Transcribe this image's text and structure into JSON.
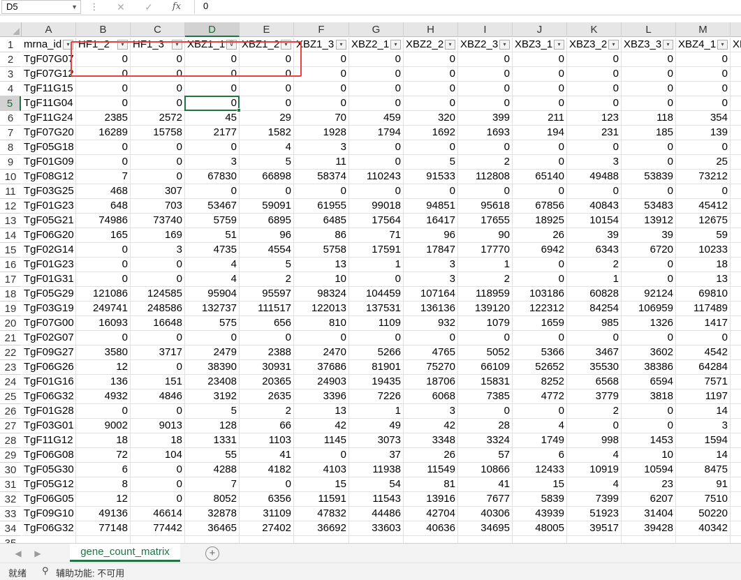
{
  "formula_bar": {
    "name_box": "D5",
    "cancel_icon": "✕",
    "enter_icon": "✓",
    "fx_label": "fx",
    "value": "0"
  },
  "columns": [
    "A",
    "B",
    "C",
    "D",
    "E",
    "F",
    "G",
    "H",
    "I",
    "J",
    "K",
    "L",
    "M"
  ],
  "selected_column": "D",
  "selected_row": "5",
  "headers": [
    "mrna_id",
    "HF1_2",
    "HF1_3",
    "XBZ1_1",
    "XBZ1_2",
    "XBZ1_3",
    "XBZ2_1",
    "XBZ2_2",
    "XBZ2_3",
    "XBZ3_1",
    "XBZ3_2",
    "XBZ3_3",
    "XBZ4_1"
  ],
  "next_header_fragment": "XB",
  "filter_icon": "▾",
  "active_filter_icon": "⊽",
  "rows": [
    {
      "n": "2",
      "id": "TgF07G07",
      "v": [
        "0",
        "0",
        "0",
        "0",
        "0",
        "0",
        "0",
        "0",
        "0",
        "0",
        "0",
        "0"
      ]
    },
    {
      "n": "3",
      "id": "TgF07G12",
      "v": [
        "0",
        "0",
        "0",
        "0",
        "0",
        "0",
        "0",
        "0",
        "0",
        "0",
        "0",
        "0"
      ]
    },
    {
      "n": "4",
      "id": "TgF11G15",
      "v": [
        "0",
        "0",
        "0",
        "0",
        "0",
        "0",
        "0",
        "0",
        "0",
        "0",
        "0",
        "0"
      ]
    },
    {
      "n": "5",
      "id": "TgF11G04",
      "v": [
        "0",
        "0",
        "0",
        "0",
        "0",
        "0",
        "0",
        "0",
        "0",
        "0",
        "0",
        "0"
      ]
    },
    {
      "n": "6",
      "id": "TgF11G24",
      "v": [
        "2385",
        "2572",
        "45",
        "29",
        "70",
        "459",
        "320",
        "399",
        "211",
        "123",
        "118",
        "354"
      ]
    },
    {
      "n": "7",
      "id": "TgF07G20",
      "v": [
        "16289",
        "15758",
        "2177",
        "1582",
        "1928",
        "1794",
        "1692",
        "1693",
        "194",
        "231",
        "185",
        "139"
      ]
    },
    {
      "n": "8",
      "id": "TgF05G18",
      "v": [
        "0",
        "0",
        "0",
        "4",
        "3",
        "0",
        "0",
        "0",
        "0",
        "0",
        "0",
        "0"
      ]
    },
    {
      "n": "9",
      "id": "TgF01G09",
      "v": [
        "0",
        "0",
        "3",
        "5",
        "11",
        "0",
        "5",
        "2",
        "0",
        "3",
        "0",
        "25"
      ]
    },
    {
      "n": "10",
      "id": "TgF08G12",
      "v": [
        "7",
        "0",
        "67830",
        "66898",
        "58374",
        "110243",
        "91533",
        "112808",
        "65140",
        "49488",
        "53839",
        "73212"
      ]
    },
    {
      "n": "11",
      "id": "TgF03G25",
      "v": [
        "468",
        "307",
        "0",
        "0",
        "0",
        "0",
        "0",
        "0",
        "0",
        "0",
        "0",
        "0"
      ]
    },
    {
      "n": "12",
      "id": "TgF01G23",
      "v": [
        "648",
        "703",
        "53467",
        "59091",
        "61955",
        "99018",
        "94851",
        "95618",
        "67856",
        "40843",
        "53483",
        "45412"
      ]
    },
    {
      "n": "13",
      "id": "TgF05G21",
      "v": [
        "74986",
        "73740",
        "5759",
        "6895",
        "6485",
        "17564",
        "16417",
        "17655",
        "18925",
        "10154",
        "13912",
        "12675"
      ]
    },
    {
      "n": "14",
      "id": "TgF06G20",
      "v": [
        "165",
        "169",
        "51",
        "96",
        "86",
        "71",
        "96",
        "90",
        "26",
        "39",
        "39",
        "59"
      ]
    },
    {
      "n": "15",
      "id": "TgF02G14",
      "v": [
        "0",
        "3",
        "4735",
        "4554",
        "5758",
        "17591",
        "17847",
        "17770",
        "6942",
        "6343",
        "6720",
        "10233"
      ]
    },
    {
      "n": "16",
      "id": "TgF01G23",
      "v": [
        "0",
        "0",
        "4",
        "5",
        "13",
        "1",
        "3",
        "1",
        "0",
        "2",
        "0",
        "18"
      ]
    },
    {
      "n": "17",
      "id": "TgF01G31",
      "v": [
        "0",
        "0",
        "4",
        "2",
        "10",
        "0",
        "3",
        "2",
        "0",
        "1",
        "0",
        "13"
      ]
    },
    {
      "n": "18",
      "id": "TgF05G29",
      "v": [
        "121086",
        "124585",
        "95904",
        "95597",
        "98324",
        "104459",
        "107164",
        "118959",
        "103186",
        "60828",
        "92124",
        "69810"
      ]
    },
    {
      "n": "19",
      "id": "TgF03G19",
      "v": [
        "249741",
        "248586",
        "132737",
        "111517",
        "122013",
        "137531",
        "136136",
        "139120",
        "122312",
        "84254",
        "106959",
        "117489"
      ]
    },
    {
      "n": "20",
      "id": "TgF07G00",
      "v": [
        "16093",
        "16648",
        "575",
        "656",
        "810",
        "1109",
        "932",
        "1079",
        "1659",
        "985",
        "1326",
        "1417"
      ]
    },
    {
      "n": "21",
      "id": "TgF02G07",
      "v": [
        "0",
        "0",
        "0",
        "0",
        "0",
        "0",
        "0",
        "0",
        "0",
        "0",
        "0",
        "0"
      ]
    },
    {
      "n": "22",
      "id": "TgF09G27",
      "v": [
        "3580",
        "3717",
        "2479",
        "2388",
        "2470",
        "5266",
        "4765",
        "5052",
        "5366",
        "3467",
        "3602",
        "4542"
      ]
    },
    {
      "n": "23",
      "id": "TgF06G26",
      "v": [
        "12",
        "0",
        "38390",
        "30931",
        "37686",
        "81901",
        "75270",
        "66109",
        "52652",
        "35530",
        "38386",
        "64284"
      ]
    },
    {
      "n": "24",
      "id": "TgF01G16",
      "v": [
        "136",
        "151",
        "23408",
        "20365",
        "24903",
        "19435",
        "18706",
        "15831",
        "8252",
        "6568",
        "6594",
        "7571"
      ]
    },
    {
      "n": "25",
      "id": "TgF06G32",
      "v": [
        "4932",
        "4846",
        "3192",
        "2635",
        "3396",
        "7226",
        "6068",
        "7385",
        "4772",
        "3779",
        "3818",
        "1197"
      ]
    },
    {
      "n": "26",
      "id": "TgF01G28",
      "v": [
        "0",
        "0",
        "5",
        "2",
        "13",
        "1",
        "3",
        "0",
        "0",
        "2",
        "0",
        "14"
      ]
    },
    {
      "n": "27",
      "id": "TgF03G01",
      "v": [
        "9002",
        "9013",
        "128",
        "66",
        "42",
        "49",
        "42",
        "28",
        "4",
        "0",
        "0",
        "3"
      ]
    },
    {
      "n": "28",
      "id": "TgF11G12",
      "v": [
        "18",
        "18",
        "1331",
        "1103",
        "1145",
        "3073",
        "3348",
        "3324",
        "1749",
        "998",
        "1453",
        "1594"
      ]
    },
    {
      "n": "29",
      "id": "TgF06G08",
      "v": [
        "72",
        "104",
        "55",
        "41",
        "0",
        "37",
        "26",
        "57",
        "6",
        "4",
        "10",
        "14"
      ]
    },
    {
      "n": "30",
      "id": "TgF05G30",
      "v": [
        "6",
        "0",
        "4288",
        "4182",
        "4103",
        "11938",
        "11549",
        "10866",
        "12433",
        "10919",
        "10594",
        "8475"
      ]
    },
    {
      "n": "31",
      "id": "TgF05G12",
      "v": [
        "8",
        "0",
        "7",
        "0",
        "15",
        "54",
        "81",
        "41",
        "15",
        "4",
        "23",
        "91"
      ]
    },
    {
      "n": "32",
      "id": "TgF06G05",
      "v": [
        "12",
        "0",
        "8052",
        "6356",
        "11591",
        "11543",
        "13916",
        "7677",
        "5839",
        "7399",
        "6207",
        "7510"
      ]
    },
    {
      "n": "33",
      "id": "TgF09G10",
      "v": [
        "49136",
        "46614",
        "32878",
        "31109",
        "47832",
        "44486",
        "42704",
        "40306",
        "43939",
        "51923",
        "31404",
        "50220"
      ]
    },
    {
      "n": "34",
      "id": "TgF06G32",
      "v": [
        "77148",
        "77442",
        "36465",
        "27402",
        "36692",
        "33603",
        "40636",
        "34695",
        "48005",
        "39517",
        "39428",
        "40342"
      ]
    }
  ],
  "sheet_tab": "gene_count_matrix",
  "add_sheet_icon": "+",
  "nav_prev_icon": "◀",
  "nav_next_icon": "▶",
  "status": {
    "ready": "就绪",
    "accessibility_icon": "⚲",
    "accessibility": "辅助功能: 不可用"
  },
  "colors": {
    "accent": "#217346",
    "annotation": "#e8413f"
  }
}
